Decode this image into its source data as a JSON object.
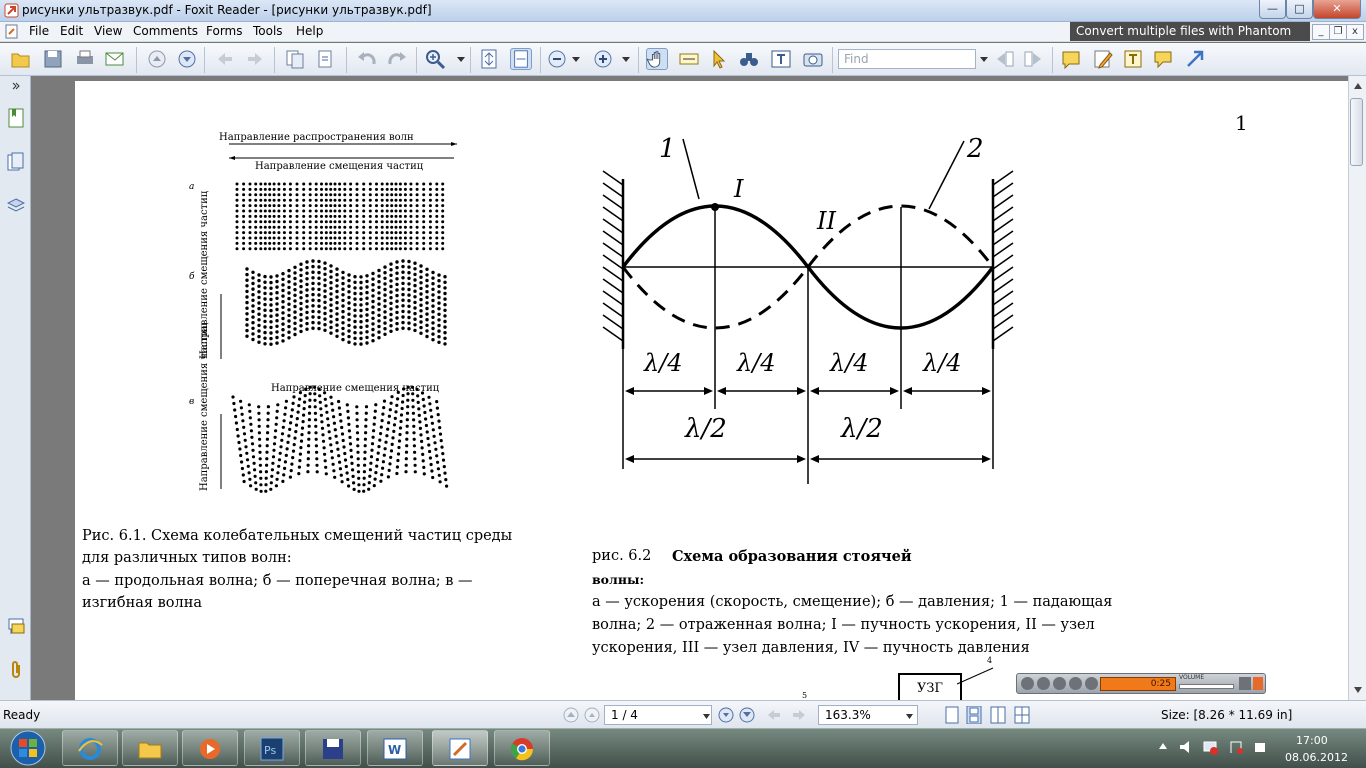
{
  "window": {
    "title": "рисунки ультразвук.pdf - Foxit Reader - [рисунки ультразвук.pdf]"
  },
  "menu": {
    "items": [
      "File",
      "Edit",
      "View",
      "Comments",
      "Forms",
      "Tools",
      "Help"
    ]
  },
  "promo": {
    "text": "Convert multiple files with Phantom"
  },
  "toolbar": {
    "find_placeholder": "Find"
  },
  "page": {
    "page_number": "1",
    "fig61": {
      "top_label": "Направление распространения волн",
      "sub_label": "Направление смещения частиц",
      "letter_a": "а",
      "letter_b": "б",
      "letter_v": "в",
      "side_label_1": "Направление смещения частиц",
      "bottom_label": "Направление смещения частиц",
      "side_label_2": "Направление смещения частиц",
      "caption_1": "Рис. 6.1. Схема колебательных смещений частиц среды",
      "caption_2": "для различных типов  волн:",
      "caption_3": "а — продольная волна; б — поперечная волна; в —",
      "caption_4": "изгибная волна"
    },
    "fig62": {
      "label_1": "1",
      "label_2": "2",
      "label_I": "I",
      "label_II": "II",
      "q1": "λ/4",
      "q2": "λ/4",
      "q3": "λ/4",
      "q4": "λ/4",
      "h1": "λ/2",
      "h2": "λ/2",
      "caption_1": "рис.  6.2  ",
      "caption_1_bold": "Схема  образования  стоячей",
      "caption_2": "волны:",
      "caption_3": "а — ускорения (скорость, смещение); б — давления; 1 — падающая",
      "caption_4": "волна; 2 — отраженная волна; I — пучность ускорения, II — узел",
      "caption_5": "ускорения, III — узел давления, IV — пучность давления"
    },
    "fig63": {
      "box_label": "УЗГ",
      "mark_4": "4",
      "mark_5": "5"
    }
  },
  "status": {
    "ready": "Ready",
    "page_field": "1 / 4",
    "zoom": "163.3%",
    "size": "Size: [8.26 * 11.69 in]"
  },
  "player": {
    "time": "0:25",
    "volume_label": "VOLUME"
  },
  "tray": {
    "time": "17:00",
    "date": "08.06.2012"
  },
  "colors": {
    "titlebar": "#c8d9ef",
    "accent": "#3d74c4"
  }
}
